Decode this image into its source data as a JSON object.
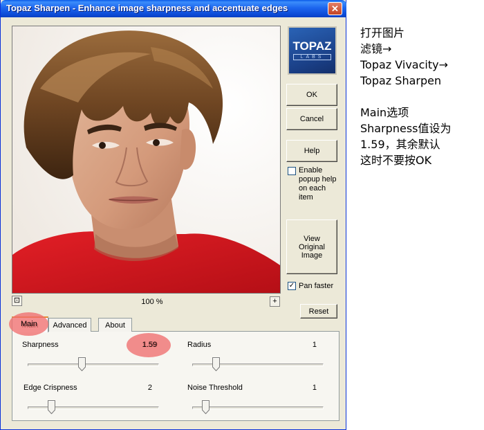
{
  "window": {
    "title": "Topaz Sharpen - Enhance image sharpness and accentuate edges",
    "close_glyph": "✕"
  },
  "logo": {
    "name": "TOPAZ",
    "sub": "LABS",
    "icon": "topaz-labs-logo"
  },
  "buttons": {
    "ok": "OK",
    "cancel": "Cancel",
    "help": "Help",
    "view_original": "View Original Image",
    "reset": "Reset"
  },
  "options": {
    "popup_help": {
      "label": "Enable popup help on each item",
      "checked": false
    },
    "pan_faster": {
      "label": "Pan faster",
      "checked": true,
      "check_glyph": "✓"
    }
  },
  "preview": {
    "zoom": "100 %",
    "zoom_in_glyph": "+",
    "fit_glyph": "⊡"
  },
  "tabs": [
    {
      "label": "Main",
      "active": true
    },
    {
      "label": "Advanced",
      "active": false
    },
    {
      "label": "About",
      "active": false
    }
  ],
  "params": [
    {
      "label": "Sharpness",
      "value": "1.59",
      "level": 0.41
    },
    {
      "label": "Radius",
      "value": "1",
      "level": 0.16
    },
    {
      "label": "Edge Crispness",
      "value": "2",
      "level": 0.16
    },
    {
      "label": "Noise Threshold",
      "value": "1",
      "level": 0.08
    }
  ],
  "annotation_color": "#f07a7a",
  "accent_colors": {
    "titlebar": "#0a4ad6",
    "tab_active": "#e68b2c"
  },
  "notes": {
    "lines_a": [
      "打开图片",
      "滤镜→",
      "Topaz  Vivacity→",
      "Topaz Sharpen"
    ],
    "lines_b": [
      "Main选项",
      "Sharpness值设为",
      "1.59，其余默认",
      "这时不要按OK"
    ]
  }
}
